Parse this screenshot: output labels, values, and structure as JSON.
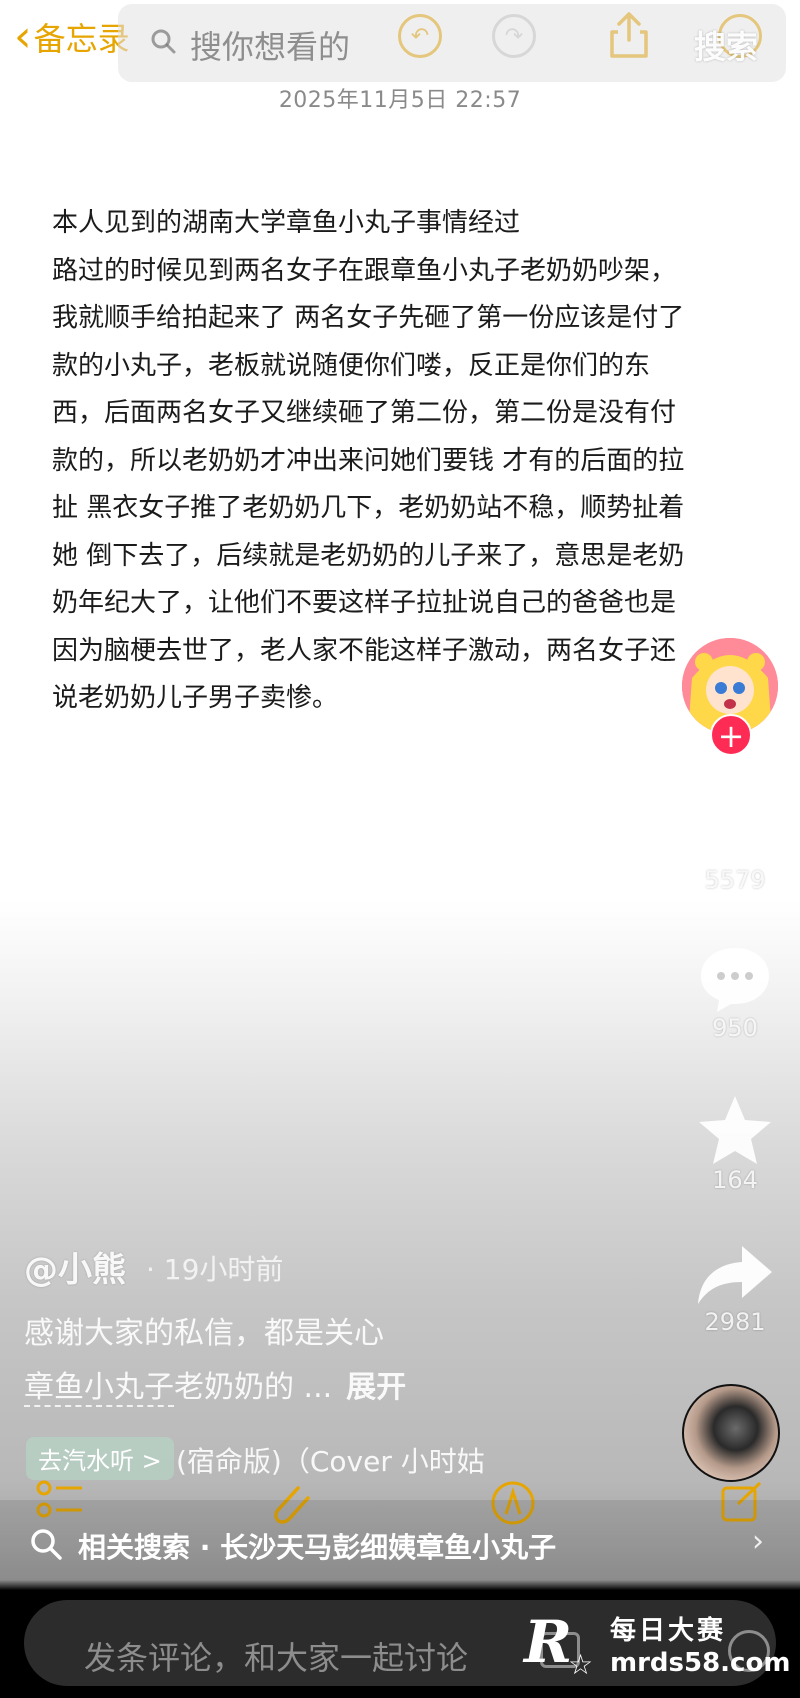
{
  "notes_app": {
    "back_label": "备忘录",
    "date": "2025年11月5日 22:57",
    "body_lines": [
      "本人见到的湖南大学章鱼小丸子事情经过",
      "路过的时候见到两名女子在跟章鱼小丸子老奶奶吵架，",
      "我就顺手给拍起来了 两名女子先砸了第一份应该是付了",
      "款的小丸子，老板就说随便你们喽，反正是你们的东",
      "西，后面两名女子又继续砸了第二份，第二份是没有付",
      "款的，所以老奶奶才冲出来问她们要钱 才有的后面的拉",
      "扯 黑衣女子推了老奶奶几下，老奶奶站不稳，顺势扯着",
      "她 倒下去了，后续就是老奶奶的儿子来了，意思是老奶",
      "奶年纪大了，让他们不要这样子拉扯说自己的爸爸也是",
      "因为脑梗去世了，老人家不能这样子激动，两名女子还",
      "说老奶奶儿子男子卖惨。"
    ]
  },
  "search": {
    "placeholder": "搜你想看的",
    "button_label": "搜索"
  },
  "actions": {
    "follow_symbol": "+",
    "likes": "5579",
    "comments": "950",
    "favorites": "164",
    "shares": "2981"
  },
  "post": {
    "author": "@小熊",
    "time": "· 19小时前",
    "caption_line1": "感谢大家的私信，都是关心",
    "caption_hashtag": "章鱼小丸子",
    "caption_rest": "老奶奶的 ...",
    "expand_label": "展开",
    "music_chip": "去汽水听 >",
    "music_title": "(宿命版)（Cover 小时姑"
  },
  "related_search": {
    "text": "相关搜索 · 长沙天马彭细姨章鱼小丸子",
    "chevron": "›"
  },
  "comment": {
    "placeholder": "发条评论，和大家一起讨论"
  },
  "watermark": {
    "letter": "R",
    "name": "每日大赛",
    "domain": "mrds58.com"
  },
  "colors": {
    "accent": "#e6a500",
    "follow": "#fe2c55"
  }
}
